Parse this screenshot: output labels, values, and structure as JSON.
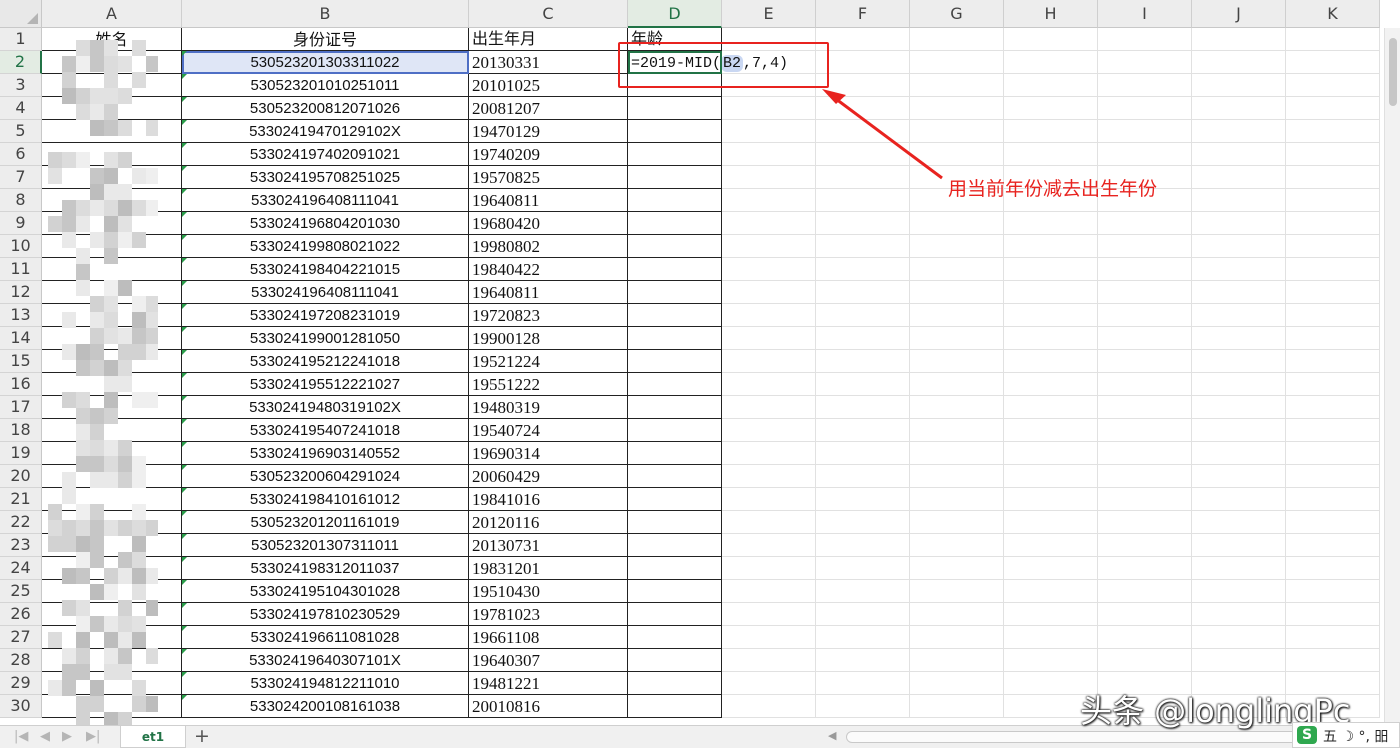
{
  "columns": [
    "A",
    "B",
    "C",
    "D",
    "E",
    "F",
    "G",
    "H",
    "I",
    "J",
    "K"
  ],
  "active_column": "D",
  "active_row": 2,
  "headers": {
    "name": "姓名",
    "id_number": "身份证号",
    "birth": "出生年月",
    "age": "年龄"
  },
  "rows": [
    {
      "num": "1"
    },
    {
      "num": "2",
      "id": "530523201303311022",
      "birth": "20130331"
    },
    {
      "num": "3",
      "id": "530523201010251011",
      "birth": "20101025"
    },
    {
      "num": "4",
      "id": "530523200812071026",
      "birth": "20081207"
    },
    {
      "num": "5",
      "id": "53302419470129102X",
      "birth": "19470129"
    },
    {
      "num": "6",
      "id": "533024197402091021",
      "birth": "19740209"
    },
    {
      "num": "7",
      "id": "533024195708251025",
      "birth": "19570825"
    },
    {
      "num": "8",
      "id": "533024196408111041",
      "birth": "19640811"
    },
    {
      "num": "9",
      "id": "533024196804201030",
      "birth": "19680420"
    },
    {
      "num": "10",
      "id": "533024199808021022",
      "birth": "19980802"
    },
    {
      "num": "11",
      "id": "533024198404221015",
      "birth": "19840422"
    },
    {
      "num": "12",
      "id": "533024196408111041",
      "birth": "19640811"
    },
    {
      "num": "13",
      "id": "533024197208231019",
      "birth": "19720823"
    },
    {
      "num": "14",
      "id": "533024199001281050",
      "birth": "19900128"
    },
    {
      "num": "15",
      "id": "533024195212241018",
      "birth": "19521224"
    },
    {
      "num": "16",
      "id": "533024195512221027",
      "birth": "19551222"
    },
    {
      "num": "17",
      "id": "53302419480319102X",
      "birth": "19480319"
    },
    {
      "num": "18",
      "id": "533024195407241018",
      "birth": "19540724"
    },
    {
      "num": "19",
      "id": "533024196903140552",
      "birth": "19690314"
    },
    {
      "num": "20",
      "id": "530523200604291024",
      "birth": "20060429"
    },
    {
      "num": "21",
      "id": "533024198410161012",
      "birth": "19841016"
    },
    {
      "num": "22",
      "id": "530523201201161019",
      "birth": "20120116"
    },
    {
      "num": "23",
      "id": "530523201307311011",
      "birth": "20130731"
    },
    {
      "num": "24",
      "id": "533024198312011037",
      "birth": "19831201"
    },
    {
      "num": "25",
      "id": "533024195104301028",
      "birth": "19510430"
    },
    {
      "num": "26",
      "id": "533024197810230529",
      "birth": "19781023"
    },
    {
      "num": "27",
      "id": "533024196611081028",
      "birth": "19661108"
    },
    {
      "num": "28",
      "id": "53302419640307101X",
      "birth": "19640307"
    },
    {
      "num": "29",
      "id": "533024194812211010",
      "birth": "19481221"
    },
    {
      "num": "30",
      "id": "533024200108161038",
      "birth": "20010816"
    }
  ],
  "formula": {
    "prefix": "=2019-MID(",
    "ref": "B2",
    "suffix": ",7,4)"
  },
  "annotation": "用当前年份减去出生年份",
  "annotation_color": "#e8231f",
  "sheet_tab": "et1",
  "add_sheet": "+",
  "watermark": "头条 @longlingPc",
  "ime": {
    "logo": "S",
    "text": "五 ☽ °, 昍"
  },
  "colors": {
    "accent": "#217346",
    "selection": "#4f6fc5"
  }
}
